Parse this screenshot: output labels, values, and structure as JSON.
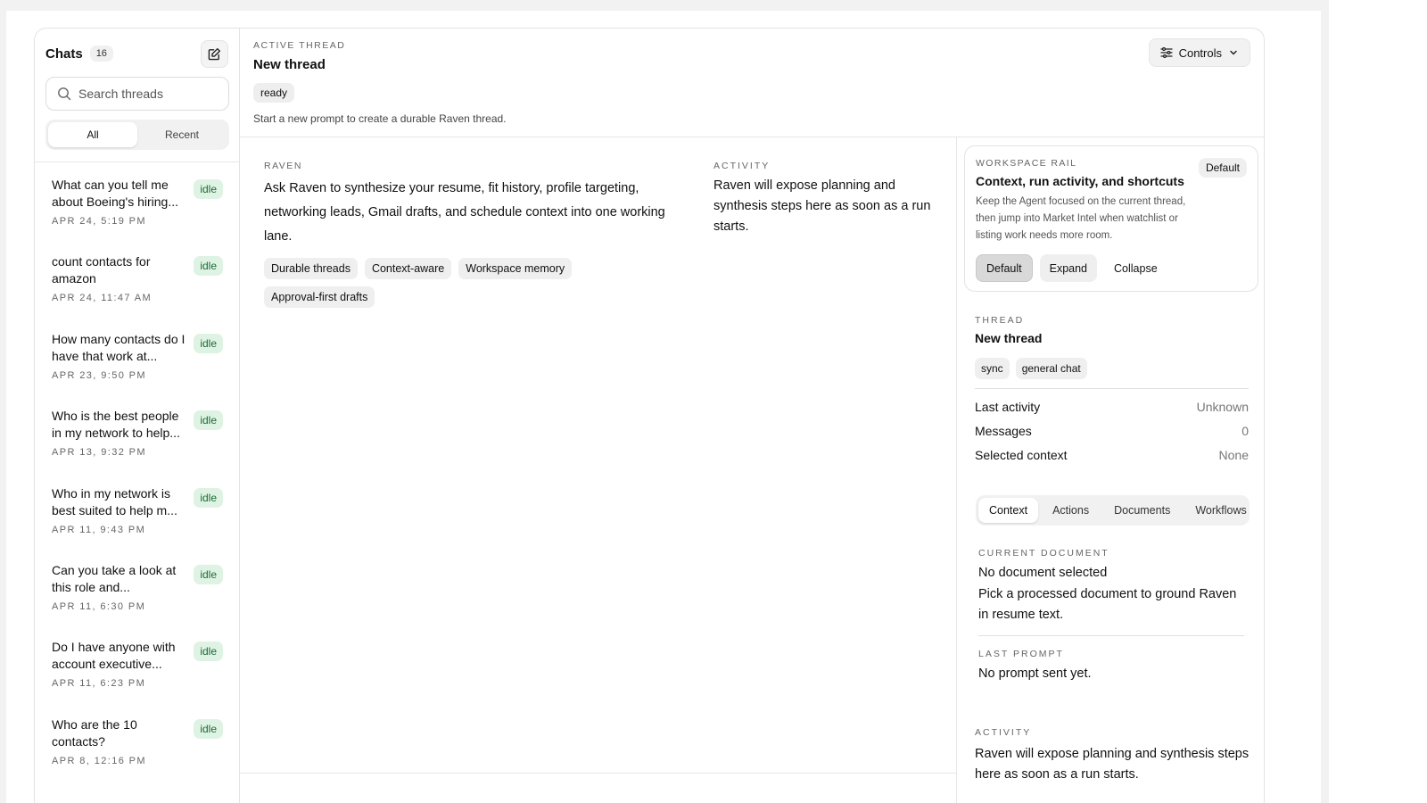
{
  "sidebar": {
    "title": "Chats",
    "count": "16",
    "search_placeholder": "Search threads",
    "filters": [
      "All",
      "Recent"
    ],
    "threads": [
      {
        "title": "What can you tell me about Boeing's hiring...",
        "time": "APR 24, 5:19 PM",
        "status": "idle"
      },
      {
        "title": "count contacts for amazon",
        "time": "APR 24, 11:47 AM",
        "status": "idle"
      },
      {
        "title": "How many contacts do I have that work at...",
        "time": "APR 23, 9:50 PM",
        "status": "idle"
      },
      {
        "title": "Who is the best people in my network to help...",
        "time": "APR 13, 9:32 PM",
        "status": "idle"
      },
      {
        "title": "Who in my network is best suited to help m...",
        "time": "APR 11, 9:43 PM",
        "status": "idle"
      },
      {
        "title": "Can you take a look at this role and...",
        "time": "APR 11, 6:30 PM",
        "status": "idle"
      },
      {
        "title": "Do I have anyone with account executive...",
        "time": "APR 11, 6:23 PM",
        "status": "idle"
      },
      {
        "title": "Who are the 10 contacts?",
        "time": "APR 8, 12:16 PM",
        "status": "idle"
      }
    ]
  },
  "header": {
    "eyebrow": "ACTIVE THREAD",
    "title": "New thread",
    "status": "ready",
    "hint": "Start a new prompt to create a durable Raven thread.",
    "controls_label": "Controls"
  },
  "conversation": {
    "raven_label": "RAVEN",
    "raven_text": "Ask Raven to synthesize your resume, fit history, profile targeting, networking leads, Gmail drafts, and schedule context into one working lane.",
    "tags": [
      "Durable threads",
      "Context-aware",
      "Workspace memory",
      "Approval-first drafts"
    ],
    "activity_label": "ACTIVITY",
    "activity_text": "Raven will expose planning and synthesis steps here as soon as a run starts."
  },
  "rail": {
    "workspace": {
      "eyebrow": "WORKSPACE RAIL",
      "badge": "Default",
      "title": "Context, run activity, and shortcuts",
      "description": "Keep the Agent focused on the current thread, then jump into Market Intel when watchlist or listing work needs more room.",
      "buttons": [
        "Default",
        "Expand",
        "Collapse"
      ]
    },
    "thread": {
      "eyebrow": "THREAD",
      "title": "New thread",
      "chips": [
        "sync",
        "general chat"
      ],
      "rows": [
        {
          "label": "Last activity",
          "value": "Unknown"
        },
        {
          "label": "Messages",
          "value": "0"
        },
        {
          "label": "Selected context",
          "value": "None"
        }
      ]
    },
    "tabs": [
      "Context",
      "Actions",
      "Documents",
      "Workflows"
    ],
    "current_document": {
      "eyebrow": "CURRENT DOCUMENT",
      "title": "No document selected",
      "text": "Pick a processed document to ground Raven in resume text."
    },
    "last_prompt": {
      "eyebrow": "LAST PROMPT",
      "text": "No prompt sent yet."
    },
    "activity": {
      "eyebrow": "ACTIVITY",
      "text": "Raven will expose planning and synthesis steps here as soon as a run starts."
    }
  }
}
